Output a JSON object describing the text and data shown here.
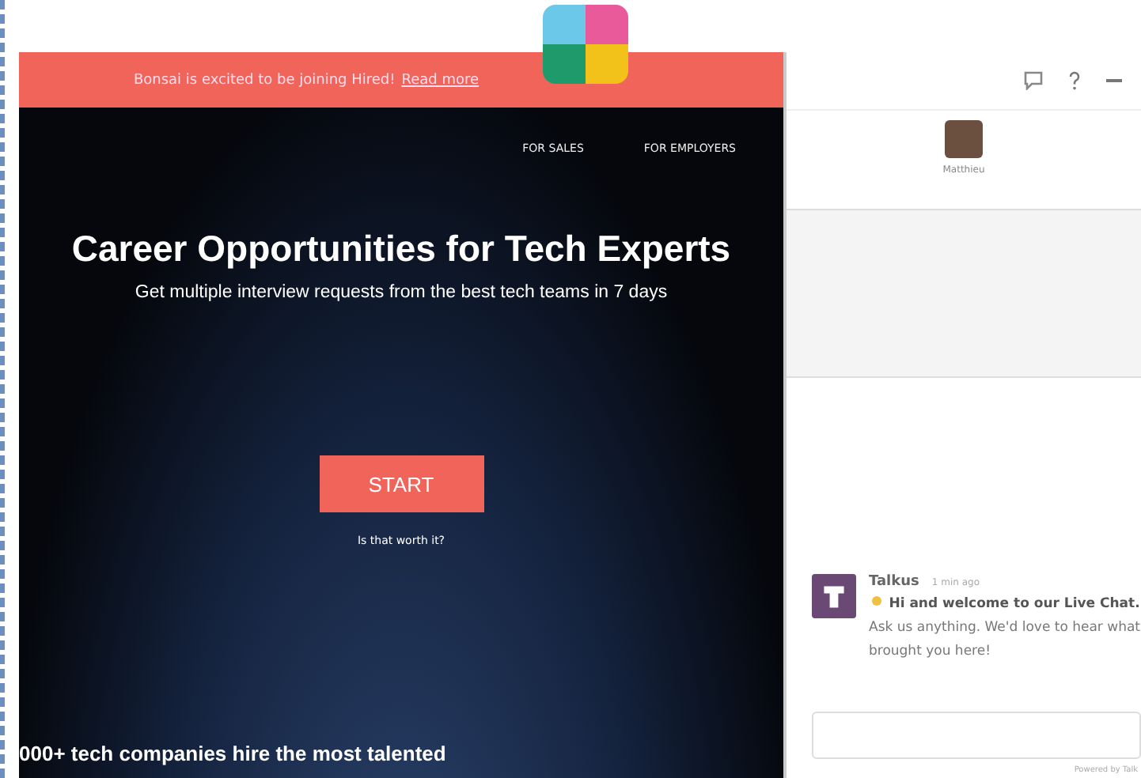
{
  "banner": {
    "text": "Bonsai is excited to be joining Hired!",
    "link": "Read more"
  },
  "nav": [
    "FOR SALES",
    "FOR EMPLOYERS"
  ],
  "hero": {
    "title": "Career Opportunities for Tech Experts",
    "subtitle": "Get multiple interview requests from the best tech teams in 7 days",
    "button": "START",
    "link": "Is that worth it?",
    "footer": "000+ tech companies hire the most talented"
  },
  "chat": {
    "agent": "Matthieu",
    "message": {
      "sender": "Talkus",
      "time": "1 min ago",
      "lead": "Hi and welcome to our Live Chat.",
      "text": "Ask us anything. We'd love to hear what brought you here!"
    },
    "powered": "Powered by Talk"
  }
}
